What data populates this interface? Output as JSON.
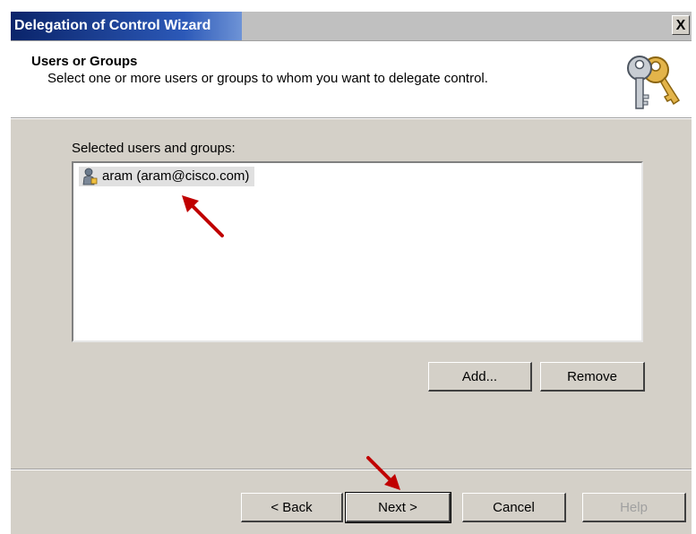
{
  "window": {
    "title": "Delegation of Control Wizard",
    "close_label": "X"
  },
  "header": {
    "title": "Users or Groups",
    "subtitle": "Select one or more users or groups to whom you want to delegate control.",
    "icon": "keys-icon"
  },
  "selection": {
    "label": "Selected users and groups:",
    "items": [
      {
        "label": "aram (aram@cisco.com)",
        "icon": "user-icon",
        "selected": true
      }
    ]
  },
  "list_buttons": {
    "add": "Add...",
    "remove": "Remove"
  },
  "nav_buttons": {
    "back": "< Back",
    "next": "Next >",
    "cancel": "Cancel",
    "help": "Help"
  },
  "colors": {
    "title_bar": "#0a246a",
    "dialog_face": "#d4d0c8",
    "annotation_arrow": "#c00000"
  }
}
